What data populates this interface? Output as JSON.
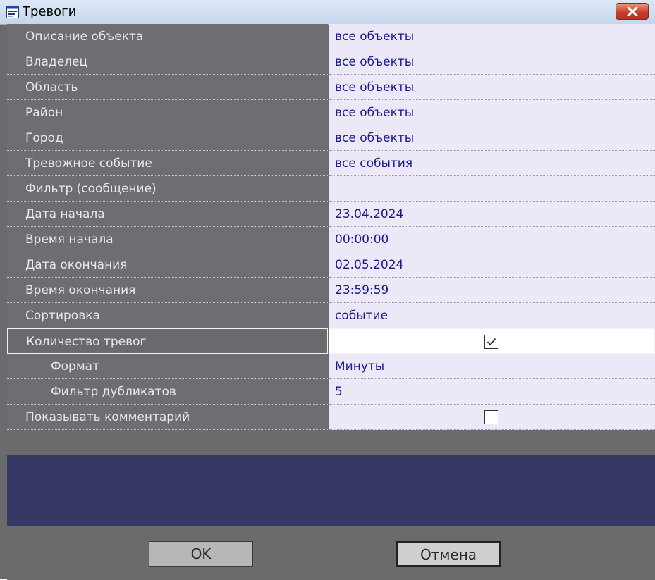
{
  "window": {
    "title": "Тревоги"
  },
  "rows": [
    {
      "label": "Описание объекта",
      "value": "все объекты"
    },
    {
      "label": "Владелец",
      "value": "все объекты"
    },
    {
      "label": "Область",
      "value": "все объекты"
    },
    {
      "label": "Район",
      "value": "все объекты"
    },
    {
      "label": "Город",
      "value": "все объекты"
    },
    {
      "label": "Тревожное событие",
      "value": "все события"
    },
    {
      "label": "Фильтр (сообщение)",
      "value": ""
    },
    {
      "label": "Дата начала",
      "value": "23.04.2024"
    },
    {
      "label": "Время начала",
      "value": "00:00:00"
    },
    {
      "label": "Дата окончания",
      "value": "02.05.2024"
    },
    {
      "label": "Время окончания",
      "value": "23:59:59"
    },
    {
      "label": "Сортировка",
      "value": "событие"
    },
    {
      "label": "Количество тревог",
      "checked": true
    },
    {
      "label": "Формат",
      "value": "Минуты"
    },
    {
      "label": "Фильтр дубликатов",
      "value": "5"
    },
    {
      "label": "Показывать комментарий",
      "checked": false
    }
  ],
  "buttons": {
    "ok": "OK",
    "cancel": "Отмена"
  },
  "icons": {
    "window": "window-icon",
    "close": "close-icon",
    "check": "checkmark-icon"
  }
}
